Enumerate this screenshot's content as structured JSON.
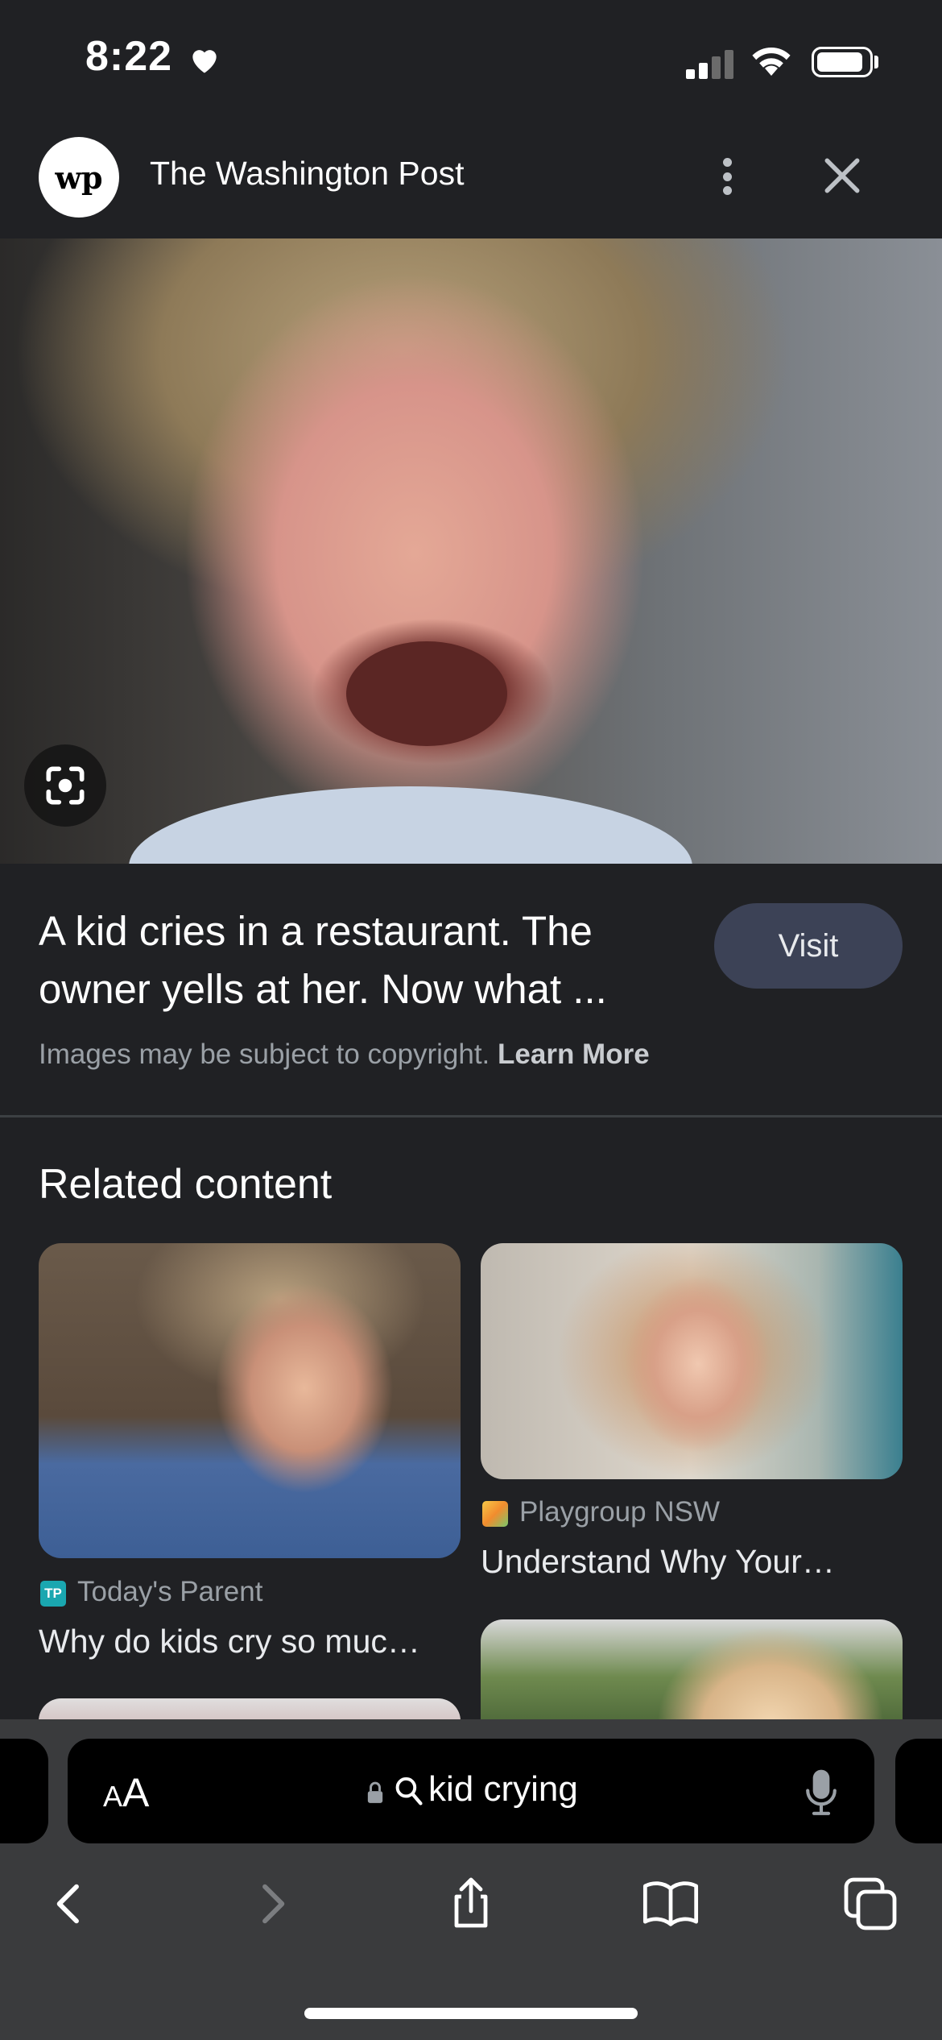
{
  "status_bar": {
    "time": "8:22",
    "focus_icon": "heart-icon",
    "signal_icon": "cellular-signal-icon",
    "wifi_icon": "wifi-icon",
    "battery_icon": "battery-icon"
  },
  "header": {
    "logo_text": "wp",
    "source_title": "The Washington Post",
    "more_icon": "more-vert-icon",
    "close_icon": "close-icon"
  },
  "hero": {
    "lens_icon": "google-lens-icon"
  },
  "result": {
    "title": "A kid cries in a restaurant. The owner yells at her. Now what ...",
    "visit_label": "Visit",
    "copyright_text": "Images may be subject to copyright.",
    "learn_more_label": "Learn More"
  },
  "related": {
    "heading": "Related content",
    "items": [
      {
        "source": "Today's Parent",
        "favicon_text": "TP",
        "title": "Why do kids cry so muc…"
      },
      {
        "source": "Playgroup NSW",
        "favicon_text": "",
        "title": "Understand Why Your…"
      }
    ]
  },
  "browser": {
    "text_size_label_small": "A",
    "text_size_label_large": "A",
    "query": "kid crying",
    "lock_icon": "lock-icon",
    "search_icon": "search-icon",
    "mic_icon": "microphone-icon",
    "nav": {
      "back_icon": "chevron-left-icon",
      "forward_icon": "chevron-right-icon",
      "share_icon": "share-icon",
      "bookmarks_icon": "book-icon",
      "tabs_icon": "tabs-icon"
    }
  },
  "colors": {
    "background": "#202124",
    "visit_button": "#3c4256",
    "toolbar": "#3a3b3d"
  }
}
